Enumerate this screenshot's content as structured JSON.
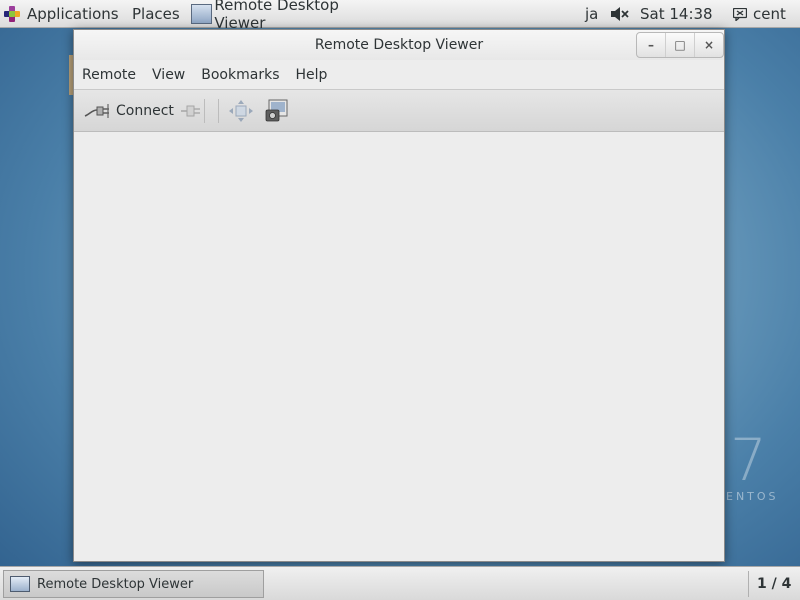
{
  "top_panel": {
    "applications_label": "Applications",
    "places_label": "Places",
    "active_window_label": "Remote Desktop Viewer",
    "keyboard_layout": "ja",
    "clock": "Sat 14:38",
    "user": "cent",
    "volume_state": "muted"
  },
  "desktop": {
    "brand_number": "7",
    "brand_word": "ENTOS"
  },
  "window": {
    "title": "Remote Desktop Viewer",
    "controls": {
      "minimize": "–",
      "maximize": "□",
      "close": "×"
    },
    "menu": [
      "Remote",
      "View",
      "Bookmarks",
      "Help"
    ],
    "toolbar": {
      "connect_label": "Connect"
    }
  },
  "bottom_panel": {
    "task_label": "Remote Desktop Viewer",
    "workspace": "1 / 4"
  },
  "colors": {
    "panel_bg": "#dcdcdc",
    "window_bg": "#ededed",
    "text": "#2e3436",
    "desktop": "#4a7fa8"
  },
  "icons": [
    "applications-logo-icon",
    "window-app-icon",
    "volume-muted-icon",
    "user-icon",
    "connect-icon",
    "disconnect-icon",
    "fullscreen-icon",
    "screenshot-icon",
    "taskbar-app-icon"
  ]
}
